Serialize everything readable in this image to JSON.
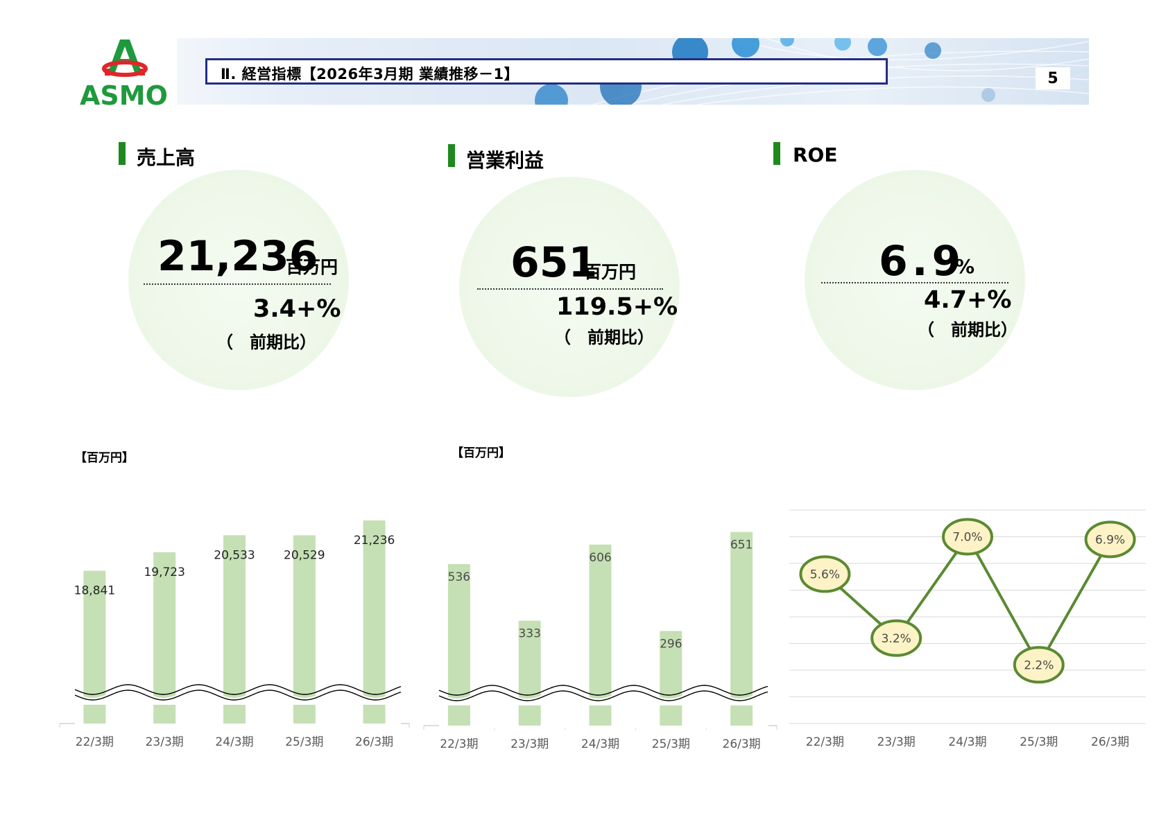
{
  "header": {
    "logo_text": "ASMO",
    "title": "Ⅱ. 経営指標【2026年3月期 業績推移－1】",
    "page_number": "5"
  },
  "kpis": [
    {
      "label": "売上高",
      "value": "21,236",
      "unit": "百万円",
      "change": "3.4+%",
      "note": "（　前期比）"
    },
    {
      "label": "営業利益",
      "value": "651",
      "unit": "百万円",
      "change": "119.5+%",
      "note": "（　前期比）"
    },
    {
      "label": "ROE",
      "value": "6.9",
      "unit": "%",
      "change": "4.7+%",
      "note": "（　前期比）"
    }
  ],
  "colors": {
    "accent_green": "#1e8a1e",
    "bar_fill": "#c5e0b4",
    "line_green": "#5b8a32",
    "marker_fill": "#fdf3c6",
    "title_border": "#232c84"
  },
  "chart_data": [
    {
      "type": "bar",
      "unit_label": "【百万円】",
      "categories": [
        "22/3期",
        "23/3期",
        "24/3期",
        "25/3期",
        "26/3期"
      ],
      "values": [
        18841,
        19723,
        20533,
        20529,
        21236
      ],
      "value_labels": [
        "18,841",
        "19,723",
        "20,533",
        "20,529",
        "21,236"
      ],
      "axis_break": true
    },
    {
      "type": "bar",
      "unit_label": "【百万円】",
      "categories": [
        "22/3期",
        "23/3期",
        "24/3期",
        "25/3期",
        "26/3期"
      ],
      "values": [
        536,
        333,
        606,
        296,
        651
      ],
      "value_labels": [
        "536",
        "333",
        "606",
        "296",
        "651"
      ],
      "axis_break": true
    },
    {
      "type": "line",
      "categories": [
        "22/3期",
        "23/3期",
        "24/3期",
        "25/3期",
        "26/3期"
      ],
      "values": [
        5.6,
        3.2,
        7.0,
        2.2,
        6.9
      ],
      "value_labels": [
        "5.6%",
        "3.2%",
        "7.0%",
        "2.2%",
        "6.9%"
      ],
      "grid": true
    }
  ]
}
